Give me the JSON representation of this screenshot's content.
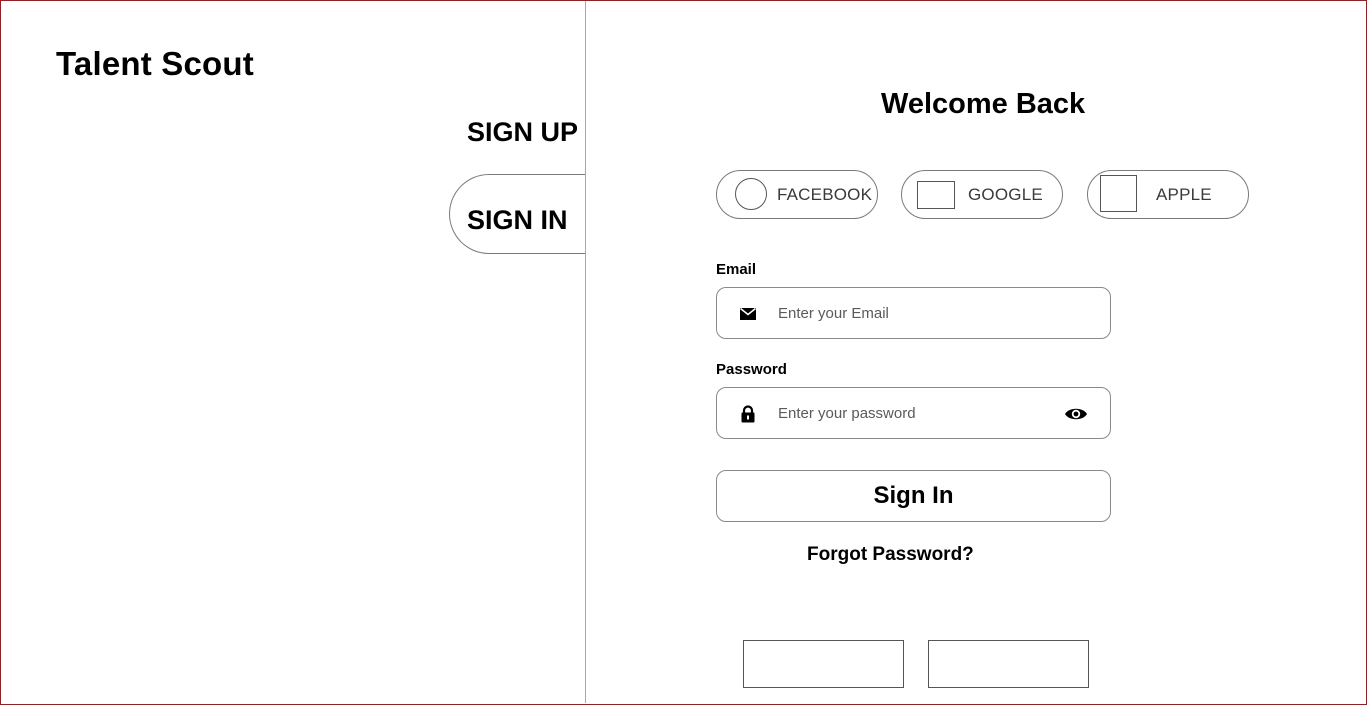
{
  "app": {
    "title": "Talent Scout"
  },
  "nav": {
    "sign_up_label": "SIGN UP",
    "sign_in_label": "SIGN IN"
  },
  "login": {
    "heading": "Welcome Back",
    "social": {
      "facebook_label": "FACEBOOK",
      "google_label": "GOOGLE",
      "apple_label": "APPLE"
    },
    "email": {
      "label": "Email",
      "placeholder": "Enter your Email",
      "value": ""
    },
    "password": {
      "label": "Password",
      "placeholder": "Enter your password",
      "value": ""
    },
    "submit_label": "Sign In",
    "forgot_label": "Forgot Password?"
  },
  "icons": {
    "email": "envelope-icon",
    "password": "lock-icon",
    "toggle_visibility": "eye-icon"
  },
  "colors": {
    "frame_border": "#d8000c",
    "divider": "#a9a9a9",
    "outline": "#7a7a7a"
  }
}
